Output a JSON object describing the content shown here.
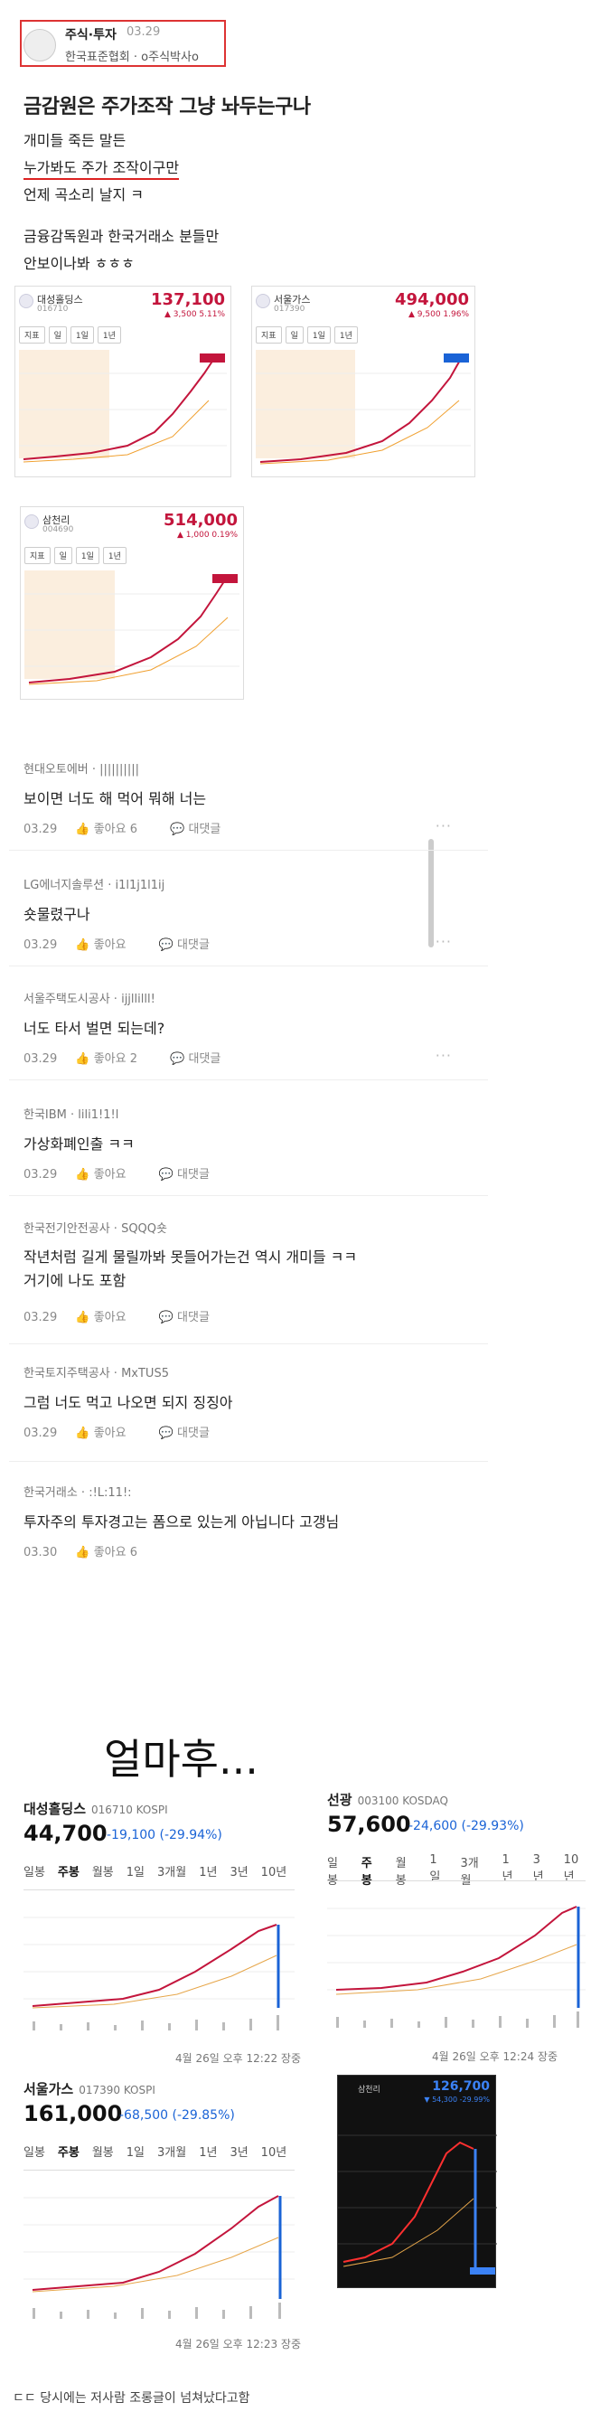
{
  "post": {
    "board": "주식·투자",
    "date": "03.29",
    "org": "한국표준협회 · o주식박사o",
    "title": "금감원은 주가조작 그냥 놔두는구나",
    "lines": [
      "개미들 죽든 말든",
      "누가봐도 주가 조작이구만",
      "언제 곡소리 날지 ㅋ",
      "금융감독원과 한국거래소 분들만",
      "안보이나봐 ㅎㅎㅎ"
    ]
  },
  "mini_quotes": [
    {
      "name": "대성홀딩스",
      "code": "016710",
      "price": "137,100",
      "change": "▲ 3,500 5.11%",
      "tabs": [
        "지표",
        "일",
        "1일",
        "1년"
      ]
    },
    {
      "name": "서울가스",
      "code": "017390",
      "price": "494,000",
      "change": "▲ 9,500 1.96%",
      "tabs": [
        "지표",
        "일",
        "1일",
        "1년"
      ]
    },
    {
      "name": "삼천리",
      "code": "004690",
      "price": "514,000",
      "change": "▲ 1,000 0.19%",
      "tabs": [
        "지표",
        "일",
        "1일",
        "1년"
      ]
    }
  ],
  "comments": [
    {
      "author": "현대오토에버 · ||||||||||",
      "text": "보이면 너도 해 먹어 뭐해 너는",
      "date": "03.29",
      "likes": "좋아요 6",
      "reply": "대댓글"
    },
    {
      "author": "LG에너지솔루션 · i1l1j1l1ij",
      "text": "숏물렸구나",
      "date": "03.29",
      "likes": "좋아요",
      "reply": "대댓글"
    },
    {
      "author": "서울주택도시공사 · ijjllilll!",
      "text": "너도 타서 벌면 되는데?",
      "date": "03.29",
      "likes": "좋아요 2",
      "reply": "대댓글"
    },
    {
      "author": "한국IBM · lili1!1!l",
      "text": "가상화폐인출 ㅋㅋ",
      "date": "03.29",
      "likes": "좋아요",
      "reply": "대댓글"
    },
    {
      "author": "한국전기안전공사 · SQQQ숏",
      "text": "작년처럼 길게 물릴까봐 못들어가는건 역시 개미들 ㅋㅋ\n거기에 나도 포함",
      "date": "03.29",
      "likes": "좋아요",
      "reply": "대댓글"
    },
    {
      "author": "한국토지주택공사 · MxTUS5",
      "text": "그럼 너도 먹고 나오면 되지 징징아",
      "date": "03.29",
      "likes": "좋아요",
      "reply": "대댓글"
    },
    {
      "author": "한국거래소 · :!L:11!:",
      "text": "투자주의 투자경고는 폼으로 있는게 아닙니다 고갱님",
      "date": "03.30",
      "likes": "좋아요 6",
      "reply": ""
    }
  ],
  "after_text": "얼마후...",
  "quotes": [
    {
      "name": "대성홀딩스",
      "code": "016710 KOSPI",
      "price": "44,700",
      "change": "-19,100 (-29.94%)",
      "tabs": [
        "일봉",
        "주봉",
        "월봉",
        "1일",
        "3개월",
        "1년",
        "3년",
        "10년"
      ],
      "stamp": "4월 26일 오후 12:22 장중"
    },
    {
      "name": "선광",
      "code": "003100 KOSDAQ",
      "price": "57,600",
      "change": "-24,600 (-29.93%)",
      "tabs": [
        "일봉",
        "주봉",
        "월봉",
        "1일",
        "3개월",
        "1년",
        "3년",
        "10년"
      ],
      "stamp": "4월 26일 오후 12:24 장중"
    },
    {
      "name": "서울가스",
      "code": "017390 KOSPI",
      "price": "161,000",
      "change": "-68,500 (-29.85%)",
      "tabs": [
        "일봉",
        "주봉",
        "월봉",
        "1일",
        "3개월",
        "1년",
        "3년",
        "10년"
      ],
      "stamp": "4월 26일 오후 12:23 장중"
    }
  ],
  "dark_quote": {
    "name": "삼천리",
    "price": "126,700",
    "change": "▼ 54,300 -29.99%"
  },
  "footer": "ㄷㄷ 당시에는 저사람 조롱글이 넘쳐났다고함",
  "colors": {
    "up": "#c3153c",
    "down": "#1a63d6"
  }
}
